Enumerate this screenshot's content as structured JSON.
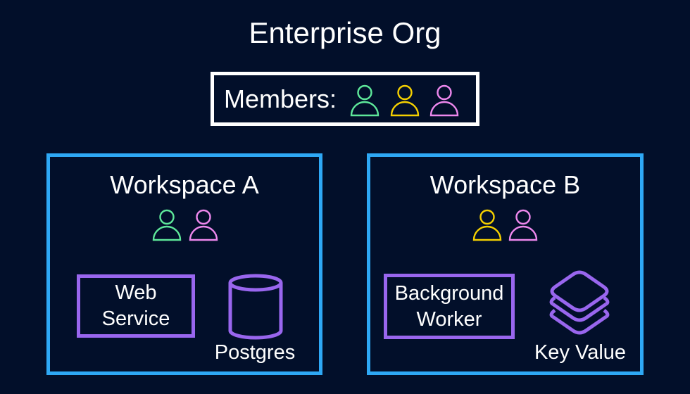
{
  "title": "Enterprise Org",
  "members": {
    "label": "Members:",
    "people": [
      {
        "icon": "user-icon",
        "color": "#5ee89a"
      },
      {
        "icon": "user-icon",
        "color": "#f5d000"
      },
      {
        "icon": "user-icon",
        "color": "#ee88ee"
      }
    ]
  },
  "colors": {
    "background": "#020f2a",
    "workspace_border": "#2ea8f5",
    "service_border": "#9966ee",
    "members_border": "#ffffff"
  },
  "workspaces": [
    {
      "title": "Workspace A",
      "people_colors": [
        "#5ee89a",
        "#ee88ee"
      ],
      "service": {
        "line1": "Web",
        "line2": "Service"
      },
      "datastore": {
        "icon": "database-cylinder-icon",
        "label": "Postgres"
      }
    },
    {
      "title": "Workspace B",
      "people_colors": [
        "#f5d000",
        "#ee88ee"
      ],
      "service": {
        "line1": "Background",
        "line2": "Worker"
      },
      "datastore": {
        "icon": "layers-stack-icon",
        "label": "Key Value"
      }
    }
  ]
}
